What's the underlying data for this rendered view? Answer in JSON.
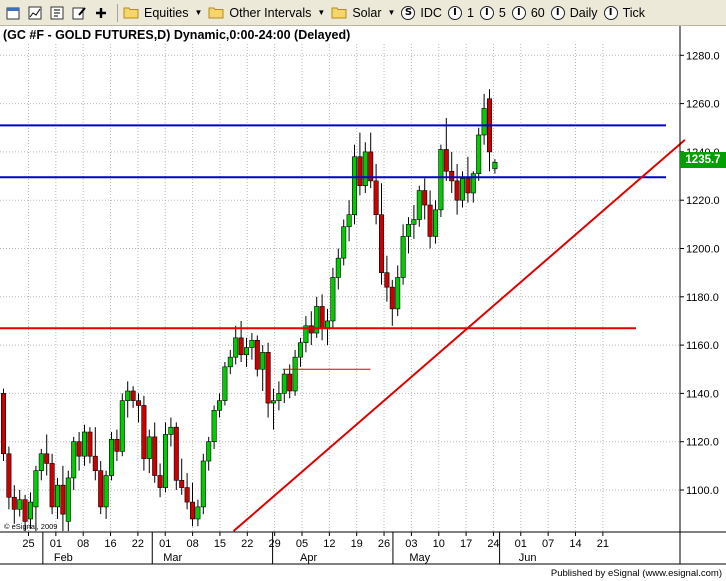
{
  "toolbar": {
    "equities_label": "Equities",
    "other_intervals_label": "Other Intervals",
    "solar_label": "Solar",
    "idc_label": "IDC",
    "interval_1_label": "1",
    "interval_5_label": "5",
    "interval_60_label": "60",
    "daily_label": "Daily",
    "tick_label": "Tick",
    "interval_icon_glyph": "I",
    "source_icon_glyph": "S"
  },
  "chart": {
    "title": "(GC #F - GOLD FUTURES,D) Dynamic,0:00-24:00 (Delayed)",
    "last_price_label": "1235.7",
    "watermark": "© eSignal, 2009",
    "footer_credit": "Published by eSignal (www.esignal.com)"
  },
  "colors": {
    "up": "#00cc00",
    "down": "#cc0000",
    "support_blue": "#0000cc",
    "trend_red": "#e00000",
    "grid": "#b8b8b8",
    "last_price_bg": "#00a000"
  },
  "chart_data": {
    "type": "candlestick",
    "title": "(GC #F - GOLD FUTURES,D) Dynamic,0:00-24:00 (Delayed)",
    "ylim": [
      1083,
      1290
    ],
    "y_ticks": [
      1100.0,
      1120.0,
      1140.0,
      1160.0,
      1180.0,
      1200.0,
      1220.0,
      1240.0,
      1260.0,
      1280.0
    ],
    "y_tick_labels": [
      "1100.0",
      "1120.0",
      "1140.0",
      "1160.0",
      "1180.0",
      "1200.0",
      "1220.0",
      "1240.0",
      "1260.0",
      "1280.0"
    ],
    "x_tick_labels": [
      "25",
      "01",
      "08",
      "16",
      "22",
      "01",
      "08",
      "15",
      "22",
      "29",
      "05",
      "12",
      "19",
      "26",
      "03",
      "10",
      "17",
      "24",
      "01",
      "07",
      "14",
      "21"
    ],
    "month_labels": [
      "Feb",
      "Mar",
      "Apr",
      "May",
      "Jun"
    ],
    "month_label_ticks": [
      1,
      5,
      10,
      14,
      18
    ],
    "month_separator_ticks": [
      1,
      5,
      9.4,
      13.8,
      17.7
    ],
    "tick_day_index": [
      2,
      7,
      12,
      17,
      21,
      25,
      30,
      35,
      40,
      45,
      50,
      55,
      60,
      65,
      70,
      75,
      80,
      85,
      90,
      94,
      99,
      104
    ],
    "candles": [
      {
        "o": 1140,
        "h": 1142,
        "l": 1112,
        "c": 1115
      },
      {
        "o": 1115,
        "h": 1118,
        "l": 1092,
        "c": 1097
      },
      {
        "o": 1097,
        "h": 1102,
        "l": 1086,
        "c": 1092
      },
      {
        "o": 1092,
        "h": 1100,
        "l": 1089,
        "c": 1096
      },
      {
        "o": 1096,
        "h": 1098,
        "l": 1083,
        "c": 1087
      },
      {
        "o": 1088,
        "h": 1099,
        "l": 1084,
        "c": 1095
      },
      {
        "o": 1093,
        "h": 1110,
        "l": 1083,
        "c": 1108
      },
      {
        "o": 1108,
        "h": 1117,
        "l": 1104,
        "c": 1115
      },
      {
        "o": 1115,
        "h": 1123,
        "l": 1106,
        "c": 1111
      },
      {
        "o": 1111,
        "h": 1115,
        "l": 1090,
        "c": 1093
      },
      {
        "o": 1093,
        "h": 1105,
        "l": 1088,
        "c": 1102
      },
      {
        "o": 1102,
        "h": 1110,
        "l": 1083,
        "c": 1090
      },
      {
        "o": 1087,
        "h": 1108,
        "l": 1083,
        "c": 1105
      },
      {
        "o": 1105,
        "h": 1122,
        "l": 1100,
        "c": 1120
      },
      {
        "o": 1120,
        "h": 1124,
        "l": 1108,
        "c": 1114
      },
      {
        "o": 1114,
        "h": 1127,
        "l": 1110,
        "c": 1124
      },
      {
        "o": 1124,
        "h": 1126,
        "l": 1111,
        "c": 1114
      },
      {
        "o": 1114,
        "h": 1126,
        "l": 1104,
        "c": 1108
      },
      {
        "o": 1108,
        "h": 1112,
        "l": 1090,
        "c": 1093
      },
      {
        "o": 1093,
        "h": 1108,
        "l": 1088,
        "c": 1106
      },
      {
        "o": 1106,
        "h": 1124,
        "l": 1104,
        "c": 1121
      },
      {
        "o": 1121,
        "h": 1125,
        "l": 1112,
        "c": 1116
      },
      {
        "o": 1116,
        "h": 1140,
        "l": 1114,
        "c": 1137
      },
      {
        "o": 1137,
        "h": 1145,
        "l": 1130,
        "c": 1141
      },
      {
        "o": 1141,
        "h": 1143,
        "l": 1134,
        "c": 1137
      },
      {
        "o": 1137,
        "h": 1140,
        "l": 1128,
        "c": 1135
      },
      {
        "o": 1135,
        "h": 1139,
        "l": 1108,
        "c": 1113
      },
      {
        "o": 1113,
        "h": 1125,
        "l": 1107,
        "c": 1122
      },
      {
        "o": 1122,
        "h": 1128,
        "l": 1103,
        "c": 1106
      },
      {
        "o": 1106,
        "h": 1111,
        "l": 1097,
        "c": 1101
      },
      {
        "o": 1101,
        "h": 1128,
        "l": 1099,
        "c": 1123
      },
      {
        "o": 1123,
        "h": 1130,
        "l": 1118,
        "c": 1126
      },
      {
        "o": 1126,
        "h": 1128,
        "l": 1100,
        "c": 1104
      },
      {
        "o": 1104,
        "h": 1113,
        "l": 1098,
        "c": 1101
      },
      {
        "o": 1101,
        "h": 1107,
        "l": 1092,
        "c": 1095
      },
      {
        "o": 1095,
        "h": 1103,
        "l": 1085,
        "c": 1088
      },
      {
        "o": 1088,
        "h": 1096,
        "l": 1085,
        "c": 1093
      },
      {
        "o": 1093,
        "h": 1115,
        "l": 1090,
        "c": 1112
      },
      {
        "o": 1112,
        "h": 1122,
        "l": 1108,
        "c": 1120
      },
      {
        "o": 1120,
        "h": 1135,
        "l": 1117,
        "c": 1133
      },
      {
        "o": 1133,
        "h": 1140,
        "l": 1130,
        "c": 1137
      },
      {
        "o": 1137,
        "h": 1153,
        "l": 1135,
        "c": 1151
      },
      {
        "o": 1151,
        "h": 1158,
        "l": 1148,
        "c": 1155
      },
      {
        "o": 1155,
        "h": 1168,
        "l": 1152,
        "c": 1163
      },
      {
        "o": 1163,
        "h": 1170,
        "l": 1153,
        "c": 1156
      },
      {
        "o": 1156,
        "h": 1163,
        "l": 1151,
        "c": 1159
      },
      {
        "o": 1159,
        "h": 1165,
        "l": 1154,
        "c": 1162
      },
      {
        "o": 1162,
        "h": 1164,
        "l": 1147,
        "c": 1150
      },
      {
        "o": 1150,
        "h": 1160,
        "l": 1141,
        "c": 1157
      },
      {
        "o": 1157,
        "h": 1161,
        "l": 1130,
        "c": 1136
      },
      {
        "o": 1136,
        "h": 1142,
        "l": 1125,
        "c": 1137
      },
      {
        "o": 1137,
        "h": 1145,
        "l": 1133,
        "c": 1140
      },
      {
        "o": 1140,
        "h": 1150,
        "l": 1136,
        "c": 1148
      },
      {
        "o": 1148,
        "h": 1152,
        "l": 1138,
        "c": 1141
      },
      {
        "o": 1141,
        "h": 1158,
        "l": 1139,
        "c": 1155
      },
      {
        "o": 1155,
        "h": 1163,
        "l": 1151,
        "c": 1161
      },
      {
        "o": 1161,
        "h": 1172,
        "l": 1157,
        "c": 1168
      },
      {
        "o": 1168,
        "h": 1174,
        "l": 1160,
        "c": 1165
      },
      {
        "o": 1165,
        "h": 1180,
        "l": 1163,
        "c": 1176
      },
      {
        "o": 1176,
        "h": 1181,
        "l": 1162,
        "c": 1167
      },
      {
        "o": 1167,
        "h": 1175,
        "l": 1160,
        "c": 1170
      },
      {
        "o": 1170,
        "h": 1192,
        "l": 1167,
        "c": 1188
      },
      {
        "o": 1188,
        "h": 1200,
        "l": 1183,
        "c": 1196
      },
      {
        "o": 1196,
        "h": 1212,
        "l": 1193,
        "c": 1209
      },
      {
        "o": 1209,
        "h": 1220,
        "l": 1203,
        "c": 1214
      },
      {
        "o": 1214,
        "h": 1243,
        "l": 1210,
        "c": 1238
      },
      {
        "o": 1238,
        "h": 1248,
        "l": 1222,
        "c": 1226
      },
      {
        "o": 1226,
        "h": 1244,
        "l": 1223,
        "c": 1240
      },
      {
        "o": 1240,
        "h": 1248,
        "l": 1225,
        "c": 1228
      },
      {
        "o": 1228,
        "h": 1235,
        "l": 1210,
        "c": 1214
      },
      {
        "o": 1214,
        "h": 1227,
        "l": 1185,
        "c": 1190
      },
      {
        "o": 1190,
        "h": 1197,
        "l": 1178,
        "c": 1184
      },
      {
        "o": 1184,
        "h": 1187,
        "l": 1168,
        "c": 1175
      },
      {
        "o": 1175,
        "h": 1193,
        "l": 1172,
        "c": 1188
      },
      {
        "o": 1188,
        "h": 1210,
        "l": 1185,
        "c": 1205
      },
      {
        "o": 1205,
        "h": 1213,
        "l": 1198,
        "c": 1210
      },
      {
        "o": 1210,
        "h": 1218,
        "l": 1204,
        "c": 1212
      },
      {
        "o": 1212,
        "h": 1226,
        "l": 1209,
        "c": 1224
      },
      {
        "o": 1224,
        "h": 1229,
        "l": 1212,
        "c": 1218
      },
      {
        "o": 1218,
        "h": 1224,
        "l": 1200,
        "c": 1205
      },
      {
        "o": 1205,
        "h": 1220,
        "l": 1202,
        "c": 1216
      },
      {
        "o": 1216,
        "h": 1243,
        "l": 1213,
        "c": 1241
      },
      {
        "o": 1241,
        "h": 1254,
        "l": 1228,
        "c": 1232
      },
      {
        "o": 1232,
        "h": 1240,
        "l": 1223,
        "c": 1228
      },
      {
        "o": 1228,
        "h": 1235,
        "l": 1214,
        "c": 1220
      },
      {
        "o": 1220,
        "h": 1232,
        "l": 1217,
        "c": 1229
      },
      {
        "o": 1229,
        "h": 1238,
        "l": 1219,
        "c": 1223
      },
      {
        "o": 1223,
        "h": 1232,
        "l": 1219,
        "c": 1231
      },
      {
        "o": 1231,
        "h": 1250,
        "l": 1228,
        "c": 1247
      },
      {
        "o": 1247,
        "h": 1264,
        "l": 1243,
        "c": 1258
      },
      {
        "o": 1262,
        "h": 1266,
        "l": 1232,
        "c": 1240
      },
      {
        "o": 1233,
        "h": 1237,
        "l": 1231,
        "c": 1235.7
      }
    ],
    "horizontal_lines": [
      {
        "name": "resistance",
        "y": 1251,
        "color": "#0000cc",
        "x_start_tick": 0,
        "x_end_tick": 21
      },
      {
        "name": "support",
        "y": 1229.5,
        "color": "#0000cc",
        "x_start_tick": 0,
        "x_end_tick": 21
      },
      {
        "name": "breakout",
        "y": 1167,
        "color": "#e00000",
        "x_start_tick": 0,
        "x_end_tick": 21
      }
    ],
    "short_line": {
      "y": 1150,
      "x_start_tick": 9.3,
      "x_end_tick": 12.5,
      "color": "#e00000"
    },
    "trendline": {
      "x0_tick": 7.5,
      "y0": 1083,
      "x1_tick": 24,
      "y1": 1245,
      "color": "#e00000"
    },
    "last_price": 1235.7
  }
}
